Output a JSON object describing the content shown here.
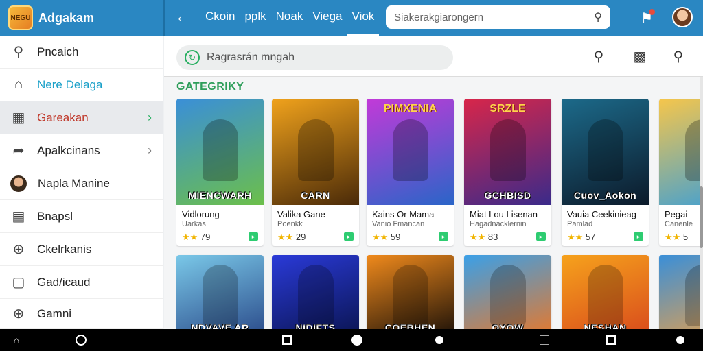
{
  "brand": {
    "logo_text": "NEGU",
    "name": "Adgakam"
  },
  "tabs": [
    "Ckoin",
    "pplk",
    "Noak",
    "Viega",
    "Viok"
  ],
  "active_tab": 4,
  "top_search": {
    "placeholder": "Siakerakgiarongern"
  },
  "sidebar": {
    "items": [
      {
        "label": "Pncaich",
        "icon": "search-icon"
      },
      {
        "label": "Nere Delaga",
        "icon": "home-icon"
      },
      {
        "label": "Gareakan",
        "icon": "grid-icon"
      },
      {
        "label": "Apalkcinans",
        "icon": "arrow-share-icon"
      },
      {
        "label": "Napla Manine",
        "icon": "user-avatar"
      },
      {
        "label": "Bnapsl",
        "icon": "document-icon"
      },
      {
        "label": "Ckelrkanis",
        "icon": "currency-icon"
      },
      {
        "label": "Gad/icaud",
        "icon": "square-icon"
      },
      {
        "label": "Gamni",
        "icon": "currency-icon"
      }
    ]
  },
  "main": {
    "search_placeholder": "Ragrasrán mngah",
    "section_title": "GATEGRIKY",
    "games_row1": [
      {
        "art_title": "MIENCWARH",
        "art_top": "",
        "name": "Vidlorung",
        "dev": "Uarkas",
        "rating": "79",
        "colors": [
          "#3a8fd8",
          "#6cbf4a"
        ]
      },
      {
        "art_title": "CARN",
        "art_top": "",
        "name": "Valika Gane",
        "dev": "Poenkk",
        "rating": "29",
        "colors": [
          "#f0a21c",
          "#4a2a08"
        ]
      },
      {
        "art_title": "",
        "art_top": "PIMXENIA",
        "name": "Kains Or Mama",
        "dev": "Vanio Fmancan",
        "rating": "59",
        "colors": [
          "#c23ad8",
          "#2a65c8"
        ]
      },
      {
        "art_title": "GCHBISD",
        "art_top": "SRZLE",
        "name": "Miat Lou Lisenan",
        "dev": "Hagadnacklernin",
        "rating": "83",
        "colors": [
          "#d8264a",
          "#3a2a8a"
        ]
      },
      {
        "art_title": "Cuov_Aokon",
        "art_top": "",
        "name": "Vauia Ceekinieag",
        "dev": "Pamlad",
        "rating": "57",
        "colors": [
          "#1c6a8a",
          "#0c1a2a"
        ]
      },
      {
        "art_title": "",
        "art_top": "",
        "name": "Pegai",
        "dev": "Canenle",
        "rating": "5",
        "colors": [
          "#f6c64b",
          "#3a9ed8"
        ]
      }
    ],
    "games_row2": [
      {
        "art_title": "NDVAVE AR",
        "colors": [
          "#7ac8e8",
          "#2a4a8a"
        ]
      },
      {
        "art_title": "NIDIFTS",
        "colors": [
          "#2a3ad8",
          "#0a1450"
        ]
      },
      {
        "art_title": "COEBHEN",
        "colors": [
          "#f08a1c",
          "#1a1008"
        ]
      },
      {
        "art_title": "OYOW",
        "colors": [
          "#3aa0e8",
          "#e8782a"
        ]
      },
      {
        "art_title": "NESHAN",
        "colors": [
          "#f6a21c",
          "#d84a1c"
        ]
      },
      {
        "art_title": "",
        "colors": [
          "#3a8fd8",
          "#e8a04a"
        ]
      }
    ]
  }
}
